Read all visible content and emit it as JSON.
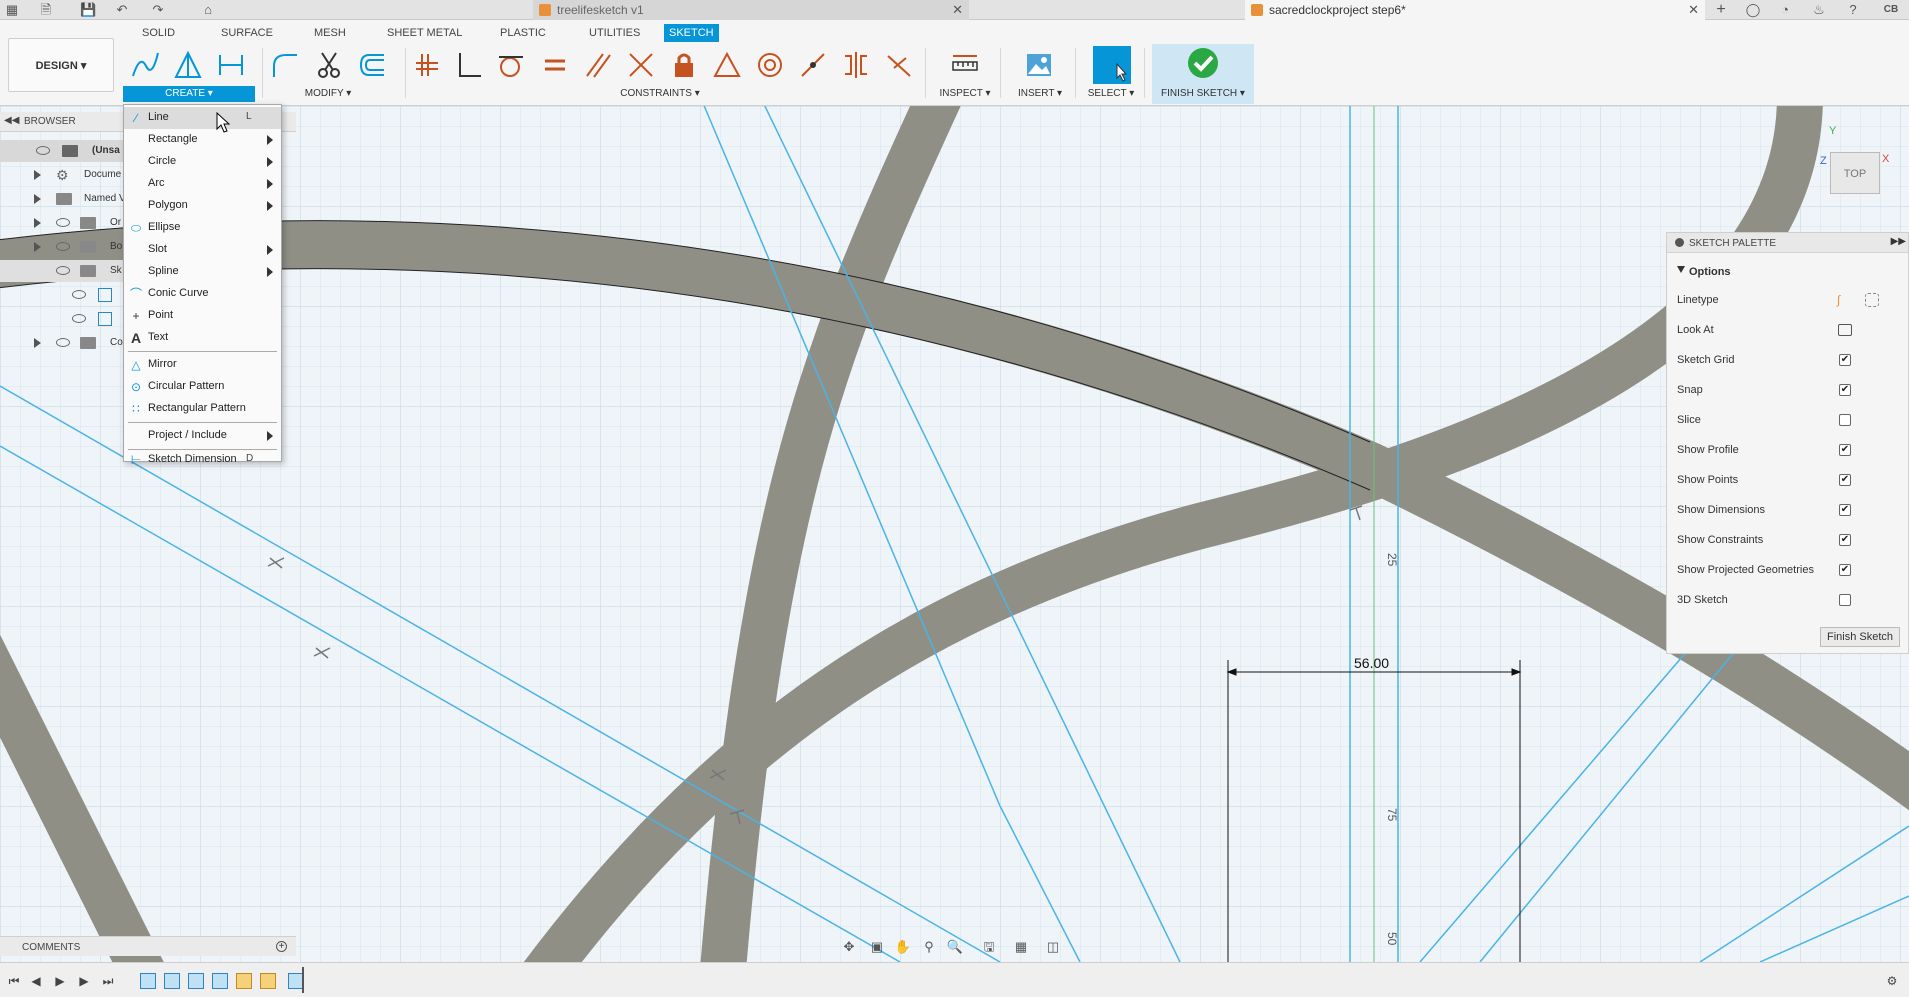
{
  "doc_tabs": [
    {
      "title": "treelifesketch v1"
    },
    {
      "title": "sacredclockproject step6*"
    }
  ],
  "ribbon": {
    "tabs": [
      "SOLID",
      "SURFACE",
      "MESH",
      "SHEET METAL",
      "PLASTIC",
      "UTILITIES",
      "SKETCH"
    ],
    "active_tab": "SKETCH",
    "workspace": "DESIGN",
    "groups": {
      "create": "CREATE",
      "modify": "MODIFY",
      "constraints": "CONSTRAINTS",
      "inspect": "INSPECT",
      "insert": "INSERT",
      "select": "SELECT",
      "finish": "FINISH SKETCH"
    }
  },
  "browser": {
    "title": "BROWSER",
    "items": [
      "(Unsa",
      "Docume",
      "Named V",
      "Or",
      "Bo",
      "Sk",
      "Co"
    ]
  },
  "create_menu": {
    "items": [
      {
        "label": "Line",
        "shortcut": "L"
      },
      {
        "label": "Rectangle"
      },
      {
        "label": "Circle"
      },
      {
        "label": "Arc"
      },
      {
        "label": "Polygon"
      },
      {
        "label": "Ellipse"
      },
      {
        "label": "Slot"
      },
      {
        "label": "Spline"
      },
      {
        "label": "Conic Curve"
      },
      {
        "label": "Point"
      },
      {
        "label": "Text"
      },
      {
        "label": "Mirror"
      },
      {
        "label": "Circular Pattern"
      },
      {
        "label": "Rectangular Pattern"
      },
      {
        "label": "Project / Include"
      },
      {
        "label": "Sketch Dimension",
        "shortcut": "D"
      }
    ]
  },
  "palette": {
    "title": "SKETCH PALETTE",
    "section": "Options",
    "rows": [
      {
        "label": "Linetype"
      },
      {
        "label": "Look At"
      },
      {
        "label": "Sketch Grid"
      },
      {
        "label": "Snap"
      },
      {
        "label": "Slice"
      },
      {
        "label": "Show Profile"
      },
      {
        "label": "Show Points"
      },
      {
        "label": "Show Dimensions"
      },
      {
        "label": "Show Constraints"
      },
      {
        "label": "Show Projected Geometries"
      },
      {
        "label": "3D Sketch"
      }
    ],
    "checked": [
      false,
      false,
      true,
      true,
      false,
      true,
      true,
      true,
      true,
      true,
      false
    ],
    "finish_button": "Finish Sketch"
  },
  "viewport": {
    "dimension_value": "56.00",
    "ruler_labels": [
      "25",
      "75",
      "50"
    ],
    "viewcube_label": "TOP",
    "axis_labels": {
      "y": "Y",
      "x": "X",
      "z": "Z"
    }
  },
  "comments": {
    "title": "COMMENTS"
  },
  "user_initials": "CB",
  "colors": {
    "accent": "#0696d7",
    "sketch_profile": "#8f8f86",
    "construction_line": "#4bb3e6",
    "finish_green": "#2aa844"
  }
}
